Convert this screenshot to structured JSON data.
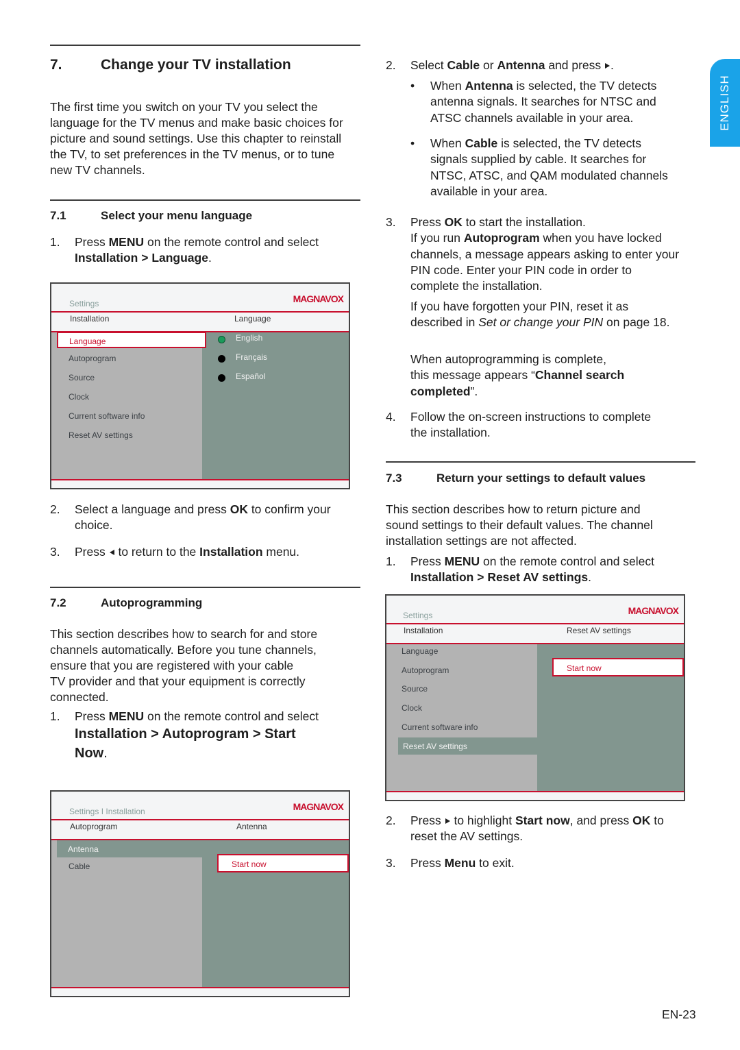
{
  "side_tab": "ENGLISH",
  "page_number": "EN-23",
  "section7": {
    "num": "7.",
    "title": "Change your TV installation",
    "intro": "The first time you switch on your TV you select the language for the TV menus and make basic choices for picture and sound settings.  Use this chapter to reinstall the TV, to set preferences in the TV menus, or to tune new TV channels."
  },
  "section71": {
    "num": "7.1",
    "title": "Select your menu language",
    "step1_num": "1.",
    "step1_pre": "Press ",
    "step1_key": "MENU",
    "step1_mid": " on the remote control and select",
    "step1_path": "Installation > Language",
    "step1_end": ".",
    "step2_num": "2.",
    "step2_pre": "Select a language and press ",
    "step2_key": "OK",
    "step2_post": " to confirm your",
    "step2_line2": "choice.",
    "step3_num": "3.",
    "step3_pre": "Press ",
    "step3_mid": " to return to the ",
    "step3_key": "Installation",
    "step3_post": " menu."
  },
  "screen1": {
    "breadcrumb": "Settings",
    "logo": "MAGNAVOX",
    "left_header": "Installation",
    "right_header": "Language",
    "menu": [
      "Language",
      "Autoprogram",
      "Source",
      "Clock",
      "Current software info",
      "Reset AV settings"
    ],
    "selected_menu": "Language",
    "options": [
      {
        "label": "English",
        "selected": true
      },
      {
        "label": "Français",
        "selected": false
      },
      {
        "label": "Español",
        "selected": false
      }
    ],
    "colors": {
      "accent": "#c8102e",
      "left_pane": "#b3b3b3",
      "right_pane": "#82968f",
      "radio_on": "#1a9a5a"
    }
  },
  "section72": {
    "num": "7.2",
    "title": "Autoprogramming",
    "intro_lines": [
      "This section describes how to search for and store",
      "channels automatically.  Before you tune channels,",
      "ensure that you are registered with your cable",
      "TV provider and that your equipment is correctly",
      "connected."
    ],
    "step1_num": "1.",
    "step1_pre": "Press ",
    "step1_key": "MENU",
    "step1_mid": " on the remote control and select",
    "step1_path_l1": "Installation > Autoprogram > Start",
    "step1_path_l2": "Now",
    "step1_end": ".",
    "step2_num": "2.",
    "step2_pre": "Select ",
    "step2_k1": "Cable",
    "step2_or": " or ",
    "step2_k2": "Antenna",
    "step2_post": " and press ",
    "step2_end": ".",
    "bullet1": {
      "pre": "When ",
      "key": "Antenna",
      "l1": " is selected, the TV detects",
      "l2": "antenna signals.  It searches for NTSC and",
      "l3": "ATSC channels available in your area."
    },
    "bullet2": {
      "pre": "When ",
      "key": "Cable",
      "l1": " is selected, the TV detects",
      "l2": "signals supplied by cable.  It searches for",
      "l3": "NTSC, ATSC, and QAM modulated channels",
      "l4": "available in your area."
    },
    "step3_num": "3.",
    "step3_pre": "Press ",
    "step3_key": "OK",
    "step3_post": " to start the installation.",
    "step3_p1_pre": "If you run ",
    "step3_p1_key": "Autoprogram",
    "step3_p1_post": " when you have locked",
    "step3_p1_l2": "channels, a message appears asking to enter your",
    "step3_p1_l3": "PIN code.  Enter your PIN code in order to",
    "step3_p1_l4": "complete the installation.",
    "step3_p2_l1": "If you have forgotten your PIN, reset it as",
    "step3_p2_pre": "described in ",
    "step3_p2_ital": "Set or change your PIN",
    "step3_p2_post": " on page 18.",
    "complete_l1": "When autoprogramming is complete,",
    "complete_pre": "this message appears “",
    "complete_key1": "Channel search",
    "complete_key2": "completed",
    "complete_post": "”.",
    "step4_num": "4.",
    "step4_l1": "Follow the on-screen instructions to complete",
    "step4_l2": "the installation."
  },
  "screen2": {
    "breadcrumb": "Settings I Installation",
    "logo": "MAGNAVOX",
    "left_header": "Autoprogram",
    "right_header": "Antenna",
    "menu": [
      "Antenna",
      "Cable"
    ],
    "highlighted_menu": "Antenna",
    "button": "Start now"
  },
  "section73": {
    "num": "7.3",
    "title": "Return your settings to default values",
    "intro_lines": [
      "This section describes how to return picture and",
      "sound settings to their default values. The channel",
      "installation settings are not affected."
    ],
    "step1_num": "1.",
    "step1_pre": "Press ",
    "step1_key": "MENU",
    "step1_mid": " on the remote control and select",
    "step1_path": "Installation > Reset AV settings",
    "step1_end": ".",
    "step2_num": "2.",
    "step2_pre": "Press ",
    "step2_mid": " to highlight ",
    "step2_key": "Start now",
    "step2_mid2": ", and press ",
    "step2_key2": "OK",
    "step2_post": " to",
    "step2_l2": "reset the AV settings.",
    "step3_num": "3.",
    "step3_pre": "Press ",
    "step3_key": "Menu",
    "step3_post": " to exit."
  },
  "screen3": {
    "breadcrumb": "Settings",
    "logo": "MAGNAVOX",
    "left_header": "Installation",
    "right_header": "Reset AV settings",
    "menu": [
      "Language",
      "Autoprogram",
      "Source",
      "Clock",
      "Current software info",
      "Reset AV settings"
    ],
    "highlighted_menu": "Reset AV settings",
    "button": "Start now"
  }
}
